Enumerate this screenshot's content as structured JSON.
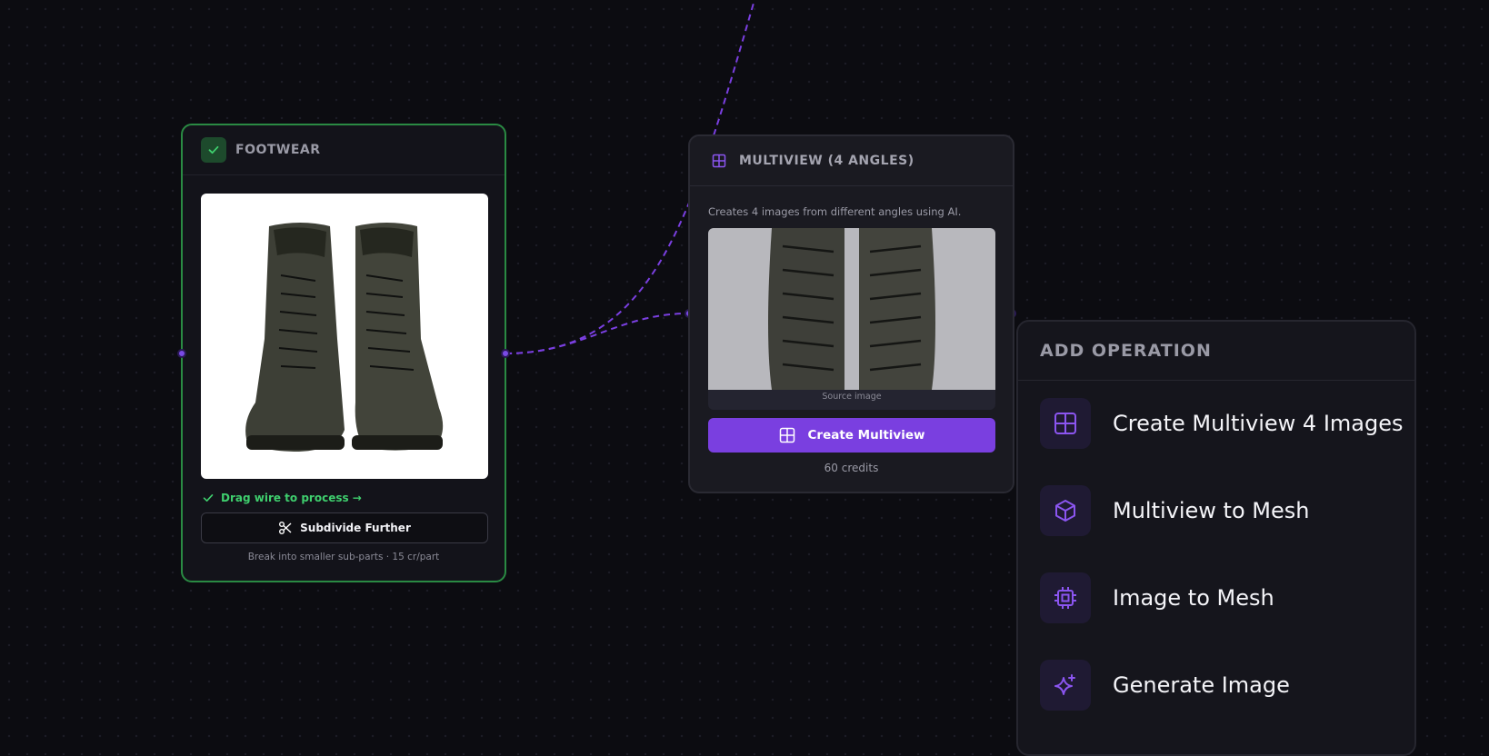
{
  "colors": {
    "accent": "#7a3fe0",
    "success": "#3fcf6e",
    "node_border_success": "#2a8a43",
    "canvas": "#0c0c11"
  },
  "footwear_node": {
    "title": "FOOTWEAR",
    "status_icon": "check-icon",
    "status": "Drag wire to process →",
    "subdivide_button": "Subdivide Further",
    "subdivide_icon": "scissors-icon",
    "note": "Break into smaller sub-parts · 15 cr/part"
  },
  "multiview_node": {
    "title": "MULTIVIEW (4 ANGLES)",
    "title_icon": "grid-icon",
    "description": "Creates 4 images from different angles using AI.",
    "image_caption": "Source image",
    "create_button": "Create Multiview",
    "credits": "60 credits"
  },
  "add_operation": {
    "title": "ADD OPERATION",
    "items": [
      {
        "label": "Create Multiview 4 Images",
        "icon": "grid-icon"
      },
      {
        "label": "Multiview to Mesh",
        "icon": "cube-icon"
      },
      {
        "label": "Image to Mesh",
        "icon": "chip-icon"
      },
      {
        "label": "Generate Image",
        "icon": "sparkle-icon"
      }
    ]
  }
}
